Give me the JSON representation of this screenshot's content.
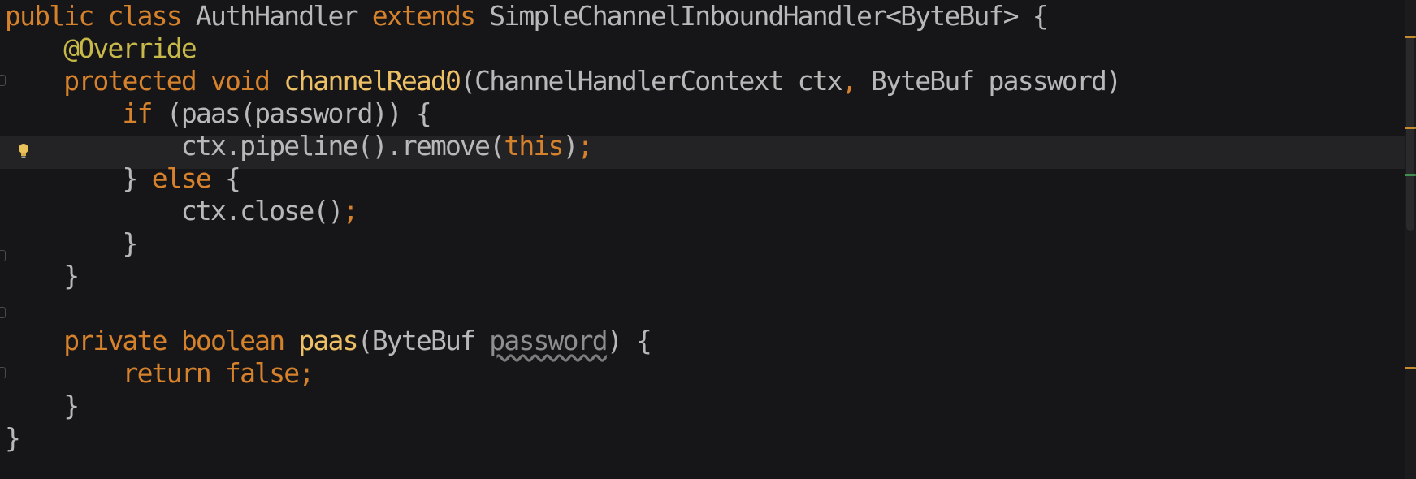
{
  "editor": {
    "lines": [
      [
        {
          "t": "public class ",
          "c": "kw"
        },
        {
          "t": "AuthHandler ",
          "c": "id"
        },
        {
          "t": "extends ",
          "c": "kw"
        },
        {
          "t": "SimpleChannelInboundHandler<ByteBuf> {",
          "c": "id"
        }
      ],
      [
        {
          "t": "    ",
          "c": "id"
        },
        {
          "t": "@Override",
          "c": "ann"
        }
      ],
      [
        {
          "t": "    ",
          "c": "id"
        },
        {
          "t": "protected void ",
          "c": "kw"
        },
        {
          "t": "channelRead0",
          "c": "fn"
        },
        {
          "t": "(ChannelHandlerContext ctx",
          "c": "id"
        },
        {
          "t": ", ",
          "c": "kw"
        },
        {
          "t": "ByteBuf password)",
          "c": "id"
        }
      ],
      [
        {
          "t": "        ",
          "c": "id"
        },
        {
          "t": "if ",
          "c": "kw"
        },
        {
          "t": "(paas(password)) {",
          "c": "id"
        }
      ],
      [
        {
          "t": "            ctx.pipeline().remove(",
          "c": "id"
        },
        {
          "t": "this",
          "c": "kw"
        },
        {
          "t": ")",
          "c": "id"
        },
        {
          "t": ";",
          "c": "kw"
        }
      ],
      [
        {
          "t": "        } ",
          "c": "id"
        },
        {
          "t": "else ",
          "c": "kw"
        },
        {
          "t": "{",
          "c": "id"
        }
      ],
      [
        {
          "t": "            ctx.close()",
          "c": "id"
        },
        {
          "t": ";",
          "c": "kw"
        }
      ],
      [
        {
          "t": "        }",
          "c": "id"
        }
      ],
      [
        {
          "t": "    }",
          "c": "id"
        }
      ],
      [
        {
          "t": "",
          "c": "id"
        }
      ],
      [
        {
          "t": "    ",
          "c": "id"
        },
        {
          "t": "private boolean ",
          "c": "kw"
        },
        {
          "t": "paas",
          "c": "fn"
        },
        {
          "t": "(ByteBuf ",
          "c": "id"
        },
        {
          "t": "password",
          "c": "unused"
        },
        {
          "t": ") {",
          "c": "id"
        }
      ],
      [
        {
          "t": "        ",
          "c": "id"
        },
        {
          "t": "return false;",
          "c": "kw"
        }
      ],
      [
        {
          "t": "    }",
          "c": "id"
        }
      ],
      [
        {
          "t": "}",
          "c": "id"
        }
      ]
    ],
    "current_line_index": 4,
    "intention_icon": "lightbulb-icon",
    "colors": {
      "background": "#161618",
      "keyword": "#d6822c",
      "method": "#eec066",
      "annotation": "#c7b84a",
      "identifier": "#b8b8b8",
      "current_line": "#232325"
    }
  }
}
